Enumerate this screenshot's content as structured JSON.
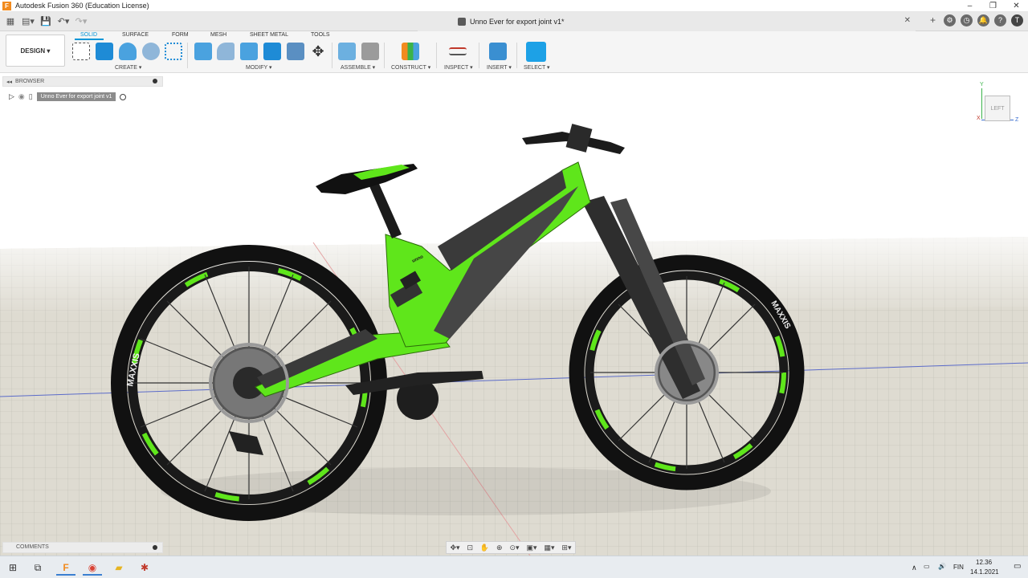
{
  "window": {
    "title": "Autodesk Fusion 360 (Education License)",
    "controls": [
      "–",
      "❐",
      "✕"
    ]
  },
  "document": {
    "tab_title": "Unno Ever for export joint v1*"
  },
  "toolbar": {
    "workspace": "DESIGN ▾",
    "tabs": [
      "SOLID",
      "SURFACE",
      "FORM",
      "MESH",
      "SHEET METAL",
      "TOOLS"
    ],
    "groups": [
      "CREATE ▾",
      "MODIFY ▾",
      "ASSEMBLE ▾",
      "CONSTRUCT ▾",
      "INSPECT ▾",
      "INSERT ▾",
      "SELECT ▾"
    ]
  },
  "browser": {
    "title": "BROWSER",
    "root_node": "Unno Ever for export joint v1"
  },
  "viewcube": {
    "face": "LEFT",
    "axis_y": "Y",
    "axis_z": "Z",
    "axis_x": "X"
  },
  "comments": {
    "title": "COMMENTS"
  },
  "tires": {
    "brand": "MAXXIS"
  },
  "frame": {
    "logo": "unno"
  },
  "taskbar": {
    "lang": "FIN",
    "time": "12.36",
    "date": "14.1.2021"
  },
  "colors": {
    "frame_green": "#5fe61b",
    "accent_blue": "#0696d7",
    "ground": "#dcdad0"
  },
  "icons": [
    "windows-icon",
    "task-view-icon",
    "fusion-icon",
    "chrome-icon",
    "file-explorer-icon",
    "app-icon"
  ]
}
